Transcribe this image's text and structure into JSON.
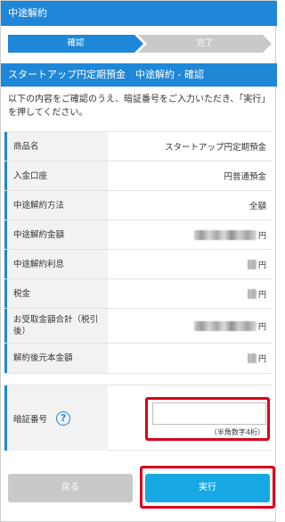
{
  "header": {
    "title": "中途解約"
  },
  "steps": [
    {
      "label": "確認",
      "state": "current"
    },
    {
      "label": "完了",
      "state": "upcoming"
    }
  ],
  "section": {
    "title": "スタートアップ円定期預金　中途解約 - 確認"
  },
  "intro": "以下の内容をご確認のうえ、暗証番号をご入力いただき、「実行」を押してください。",
  "table": {
    "rows": [
      {
        "label": "商品名",
        "value": "スタートアップ円定期預金"
      },
      {
        "label": "入金口座",
        "value": "円普通預金"
      },
      {
        "label": "中途解約方法",
        "value": "全額"
      },
      {
        "label": "中途解約金額",
        "value": "",
        "unit": "円",
        "masked": true
      },
      {
        "label": "中途解約利息",
        "value": "",
        "unit": "円",
        "masked": true
      },
      {
        "label": "税金",
        "value": "",
        "unit": "円",
        "masked": true
      },
      {
        "label": "お受取金額合計（税引後）",
        "value": "",
        "unit": "円",
        "masked": true
      },
      {
        "label": "解約後元本金額",
        "value": "",
        "unit": "円",
        "masked": true
      }
    ]
  },
  "pin": {
    "label": "暗証番号",
    "help_icon": "question-circle-icon",
    "value": "",
    "placeholder": "",
    "note": "（半角数字4桁）"
  },
  "buttons": {
    "back": "戻る",
    "execute": "実行"
  },
  "colors": {
    "brand": "#1e87d8",
    "execute": "#18a8e4",
    "disabled": "#c9c9c9",
    "highlight": "#d9001b"
  }
}
